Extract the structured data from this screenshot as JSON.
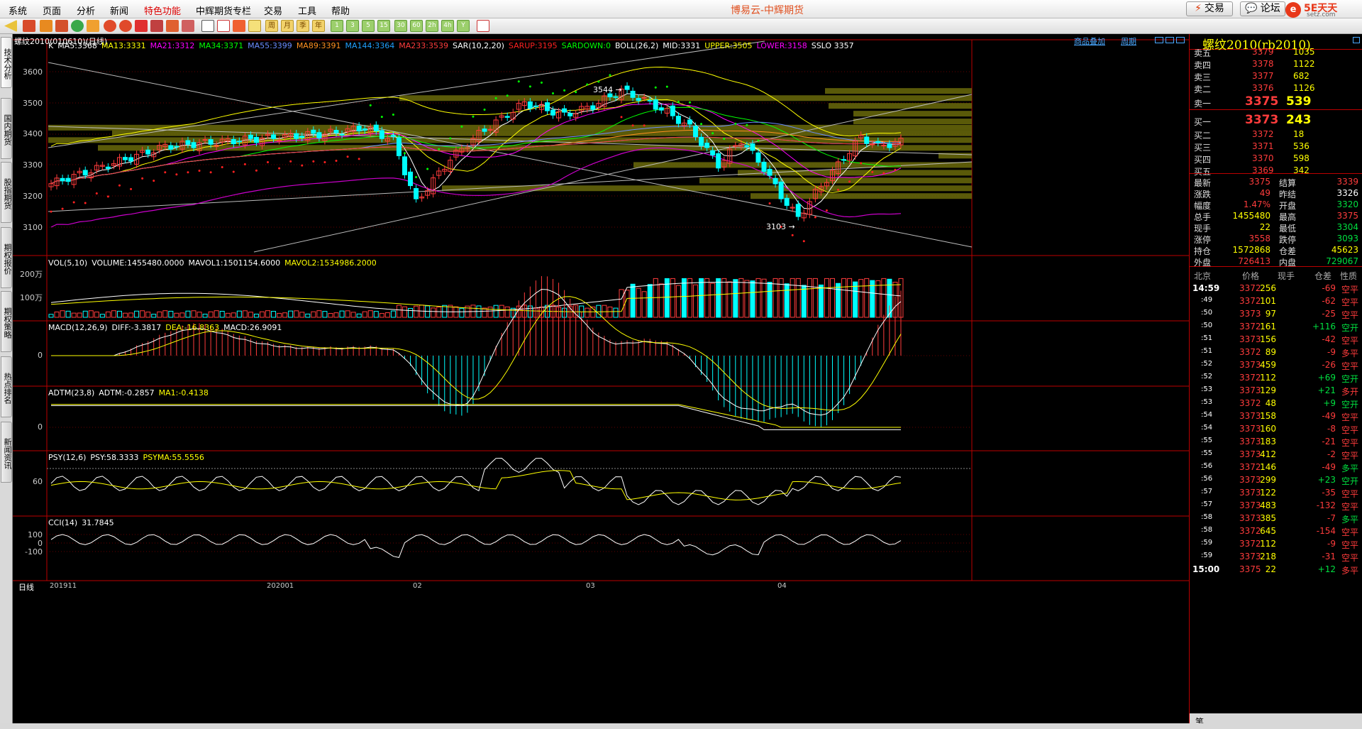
{
  "menu": [
    "系统",
    "页面",
    "分析",
    "新闻",
    "特色功能",
    "中辉期货专栏",
    "交易",
    "工具",
    "帮助"
  ],
  "app_title": "博易云-中辉期货",
  "top_buttons": {
    "trade": "交易",
    "forum": "论坛"
  },
  "logo": {
    "name": "5E天天",
    "domain": "setz.com"
  },
  "toolbar_periods": [
    "周",
    "月",
    "季",
    "年",
    "1",
    "3",
    "5",
    "15",
    "30",
    "60",
    "2h",
    "4h",
    "Y"
  ],
  "side_tabs": [
    "技术分析",
    "国内期货",
    "股指期货",
    "期权报价",
    "期权策略",
    "热点排名",
    "新闻资讯"
  ],
  "chart": {
    "contract_label": "螺纹2010(010610)(日线)",
    "links": {
      "add_product": "商品叠加",
      "period": "周期"
    },
    "main_indicators": [
      {
        "text": "K",
        "color": "#ffffff"
      },
      {
        "text": "MA5:3368",
        "color": "#ffffff"
      },
      {
        "text": "MA13:3331",
        "color": "#ffff00"
      },
      {
        "text": "MA21:3312",
        "color": "#ff00ff"
      },
      {
        "text": "MA34:3371",
        "color": "#00ff00"
      },
      {
        "text": "MA55:3399",
        "color": "#6a8cff"
      },
      {
        "text": "MA89:3391",
        "color": "#ff9020"
      },
      {
        "text": "MA144:3364",
        "color": "#20a0ff"
      },
      {
        "text": "MA233:3539",
        "color": "#ff3c3c"
      },
      {
        "text": "SAR(10,2,20)",
        "color": "#ffffff"
      },
      {
        "text": "SARUP:3195",
        "color": "#ff2020"
      },
      {
        "text": "SARDOWN:0",
        "color": "#00ff00"
      },
      {
        "text": "BOLL(26,2)",
        "color": "#ffffff"
      },
      {
        "text": "MID:3331",
        "color": "#ffffff"
      },
      {
        "text": "UPPER:3505",
        "color": "#ffff00"
      },
      {
        "text": "LOWER:3158",
        "color": "#ff00ff"
      },
      {
        "text": "SSLO 3357",
        "color": "#ffffff"
      }
    ],
    "price_axis": [
      "3600",
      "3500",
      "3400",
      "3300",
      "3200",
      "3100"
    ],
    "annotations": {
      "high": "3544",
      "low": "3103"
    },
    "vol_title": [
      {
        "text": "VOL(5,10)",
        "color": "#ffffff"
      },
      {
        "text": "VOLUME:1455480.0000",
        "color": "#ffffff"
      },
      {
        "text": "MAVOL1:1501154.6000",
        "color": "#ffffff"
      },
      {
        "text": "MAVOL2:1534986.2000",
        "color": "#ffff00"
      }
    ],
    "vol_axis": [
      "200万",
      "100万"
    ],
    "macd_title": [
      {
        "text": "MACD(12,26,9)",
        "color": "#ffffff"
      },
      {
        "text": "DIFF:-3.3817",
        "color": "#ffffff"
      },
      {
        "text": "DEA:-16.8363",
        "color": "#ffff00"
      },
      {
        "text": "MACD:26.9091",
        "color": "#ffffff"
      }
    ],
    "macd_axis": [
      "0"
    ],
    "adtm_title": [
      {
        "text": "ADTM(23,8)",
        "color": "#ffffff"
      },
      {
        "text": "ADTM:-0.2857",
        "color": "#ffffff"
      },
      {
        "text": "MA1:-0.4138",
        "color": "#ffff00"
      }
    ],
    "adtm_axis": [
      "0"
    ],
    "psy_title": [
      {
        "text": "PSY(12,6)",
        "color": "#ffffff"
      },
      {
        "text": "PSY:58.3333",
        "color": "#ffffff"
      },
      {
        "text": "PSYMA:55.5556",
        "color": "#ffff00"
      }
    ],
    "psy_axis": [
      "60"
    ],
    "cci_title": [
      {
        "text": "CCI(14)",
        "color": "#ffffff"
      },
      {
        "text": "31.7845",
        "color": "#ffffff"
      }
    ],
    "cci_axis": [
      "100",
      "0",
      "-100"
    ],
    "date_axis": [
      "201911",
      "202001",
      "02",
      "03",
      "04"
    ],
    "period_label": "日线"
  },
  "quote": {
    "title": "螺纹2010(rb2010)",
    "asks": [
      {
        "label": "卖五",
        "price": "3379",
        "vol": "1035"
      },
      {
        "label": "卖四",
        "price": "3378",
        "vol": "1122"
      },
      {
        "label": "卖三",
        "price": "3377",
        "vol": "682"
      },
      {
        "label": "卖二",
        "price": "3376",
        "vol": "1126"
      },
      {
        "label": "卖一",
        "price": "3375",
        "vol": "539"
      }
    ],
    "bids": [
      {
        "label": "买一",
        "price": "3373",
        "vol": "243"
      },
      {
        "label": "买二",
        "price": "3372",
        "vol": "18"
      },
      {
        "label": "买三",
        "price": "3371",
        "vol": "536"
      },
      {
        "label": "买四",
        "price": "3370",
        "vol": "598"
      },
      {
        "label": "买五",
        "price": "3369",
        "vol": "342"
      }
    ],
    "stats": [
      {
        "l1": "最新",
        "v1": "3375",
        "c1": "red",
        "l2": "结算",
        "v2": "3339",
        "c2": "red"
      },
      {
        "l1": "涨跌",
        "v1": "49",
        "c1": "red",
        "l2": "昨结",
        "v2": "3326",
        "c2": "wht"
      },
      {
        "l1": "幅度",
        "v1": "1.47%",
        "c1": "red",
        "l2": "开盘",
        "v2": "3320",
        "c2": "grn"
      },
      {
        "l1": "总手",
        "v1": "1455480",
        "c1": "yel",
        "l2": "最高",
        "v2": "3375",
        "c2": "red"
      },
      {
        "l1": "现手",
        "v1": "22",
        "c1": "yel",
        "l2": "最低",
        "v2": "3304",
        "c2": "grn"
      },
      {
        "l1": "涨停",
        "v1": "3558",
        "c1": "red",
        "l2": "跌停",
        "v2": "3093",
        "c2": "grn"
      },
      {
        "l1": "持仓",
        "v1": "1572868",
        "c1": "yel",
        "l2": "仓差",
        "v2": "45623",
        "c2": "yel"
      },
      {
        "l1": "外盘",
        "v1": "726413",
        "c1": "red",
        "l2": "内盘",
        "v2": "729067",
        "c2": "grn"
      }
    ],
    "tick_headers": [
      "北京",
      "价格",
      "现手",
      "仓差",
      "性质"
    ],
    "ticks": [
      {
        "t": "14:59",
        "p": "3372",
        "pc": "red",
        "v": "256",
        "oi": "-69",
        "oc": "red",
        "n": "空平",
        "nc": "red",
        "big": true
      },
      {
        "t": ":49",
        "p": "3372",
        "pc": "red",
        "v": "101",
        "oi": "-62",
        "oc": "red",
        "n": "空平",
        "nc": "red"
      },
      {
        "t": ":50",
        "p": "3373",
        "pc": "red",
        "v": "97",
        "oi": "-25",
        "oc": "red",
        "n": "空平",
        "nc": "red"
      },
      {
        "t": ":50",
        "p": "3372",
        "pc": "red",
        "v": "161",
        "oi": "+116",
        "oc": "grn",
        "n": "空开",
        "nc": "grn"
      },
      {
        "t": ":51",
        "p": "3373",
        "pc": "red",
        "v": "156",
        "oi": "-42",
        "oc": "red",
        "n": "空平",
        "nc": "red"
      },
      {
        "t": ":51",
        "p": "3372",
        "pc": "red",
        "v": "89",
        "oi": "-9",
        "oc": "red",
        "n": "多平",
        "nc": "red"
      },
      {
        "t": ":52",
        "p": "3373",
        "pc": "red",
        "v": "459",
        "oi": "-26",
        "oc": "red",
        "n": "空平",
        "nc": "red"
      },
      {
        "t": ":52",
        "p": "3372",
        "pc": "red",
        "v": "112",
        "oi": "+69",
        "oc": "grn",
        "n": "空开",
        "nc": "grn"
      },
      {
        "t": ":53",
        "p": "3373",
        "pc": "red",
        "v": "129",
        "oi": "+21",
        "oc": "grn",
        "n": "多开",
        "nc": "red"
      },
      {
        "t": ":53",
        "p": "3372",
        "pc": "red",
        "v": "48",
        "oi": "+9",
        "oc": "grn",
        "n": "空开",
        "nc": "grn"
      },
      {
        "t": ":54",
        "p": "3373",
        "pc": "red",
        "v": "158",
        "oi": "-49",
        "oc": "red",
        "n": "空平",
        "nc": "red"
      },
      {
        "t": ":54",
        "p": "3373",
        "pc": "red",
        "v": "160",
        "oi": "-8",
        "oc": "red",
        "n": "空平",
        "nc": "red"
      },
      {
        "t": ":55",
        "p": "3373",
        "pc": "red",
        "v": "183",
        "oi": "-21",
        "oc": "red",
        "n": "空平",
        "nc": "red"
      },
      {
        "t": ":55",
        "p": "3373",
        "pc": "red",
        "v": "412",
        "oi": "-2",
        "oc": "red",
        "n": "空平",
        "nc": "red"
      },
      {
        "t": ":56",
        "p": "3372",
        "pc": "red",
        "v": "146",
        "oi": "-49",
        "oc": "red",
        "n": "多平",
        "nc": "grn"
      },
      {
        "t": ":56",
        "p": "3373",
        "pc": "red",
        "v": "299",
        "oi": "+23",
        "oc": "grn",
        "n": "空开",
        "nc": "grn"
      },
      {
        "t": ":57",
        "p": "3373",
        "pc": "red",
        "v": "122",
        "oi": "-35",
        "oc": "red",
        "n": "空平",
        "nc": "red"
      },
      {
        "t": ":57",
        "p": "3373",
        "pc": "red",
        "v": "483",
        "oi": "-132",
        "oc": "red",
        "n": "空平",
        "nc": "red"
      },
      {
        "t": ":58",
        "p": "3373",
        "pc": "red",
        "v": "385",
        "oi": "-7",
        "oc": "red",
        "n": "多平",
        "nc": "grn"
      },
      {
        "t": ":58",
        "p": "3372",
        "pc": "red",
        "v": "645",
        "oi": "-154",
        "oc": "red",
        "n": "空平",
        "nc": "red"
      },
      {
        "t": ":59",
        "p": "3372",
        "pc": "red",
        "v": "112",
        "oi": "-9",
        "oc": "red",
        "n": "空平",
        "nc": "red"
      },
      {
        "t": ":59",
        "p": "3373",
        "pc": "red",
        "v": "218",
        "oi": "-31",
        "oc": "red",
        "n": "空平",
        "nc": "red"
      },
      {
        "t": "15:00",
        "p": "3375",
        "pc": "red",
        "v": "22",
        "oi": "+12",
        "oc": "grn",
        "n": "多平",
        "nc": "red",
        "big": true
      }
    ],
    "footer": "笔"
  }
}
